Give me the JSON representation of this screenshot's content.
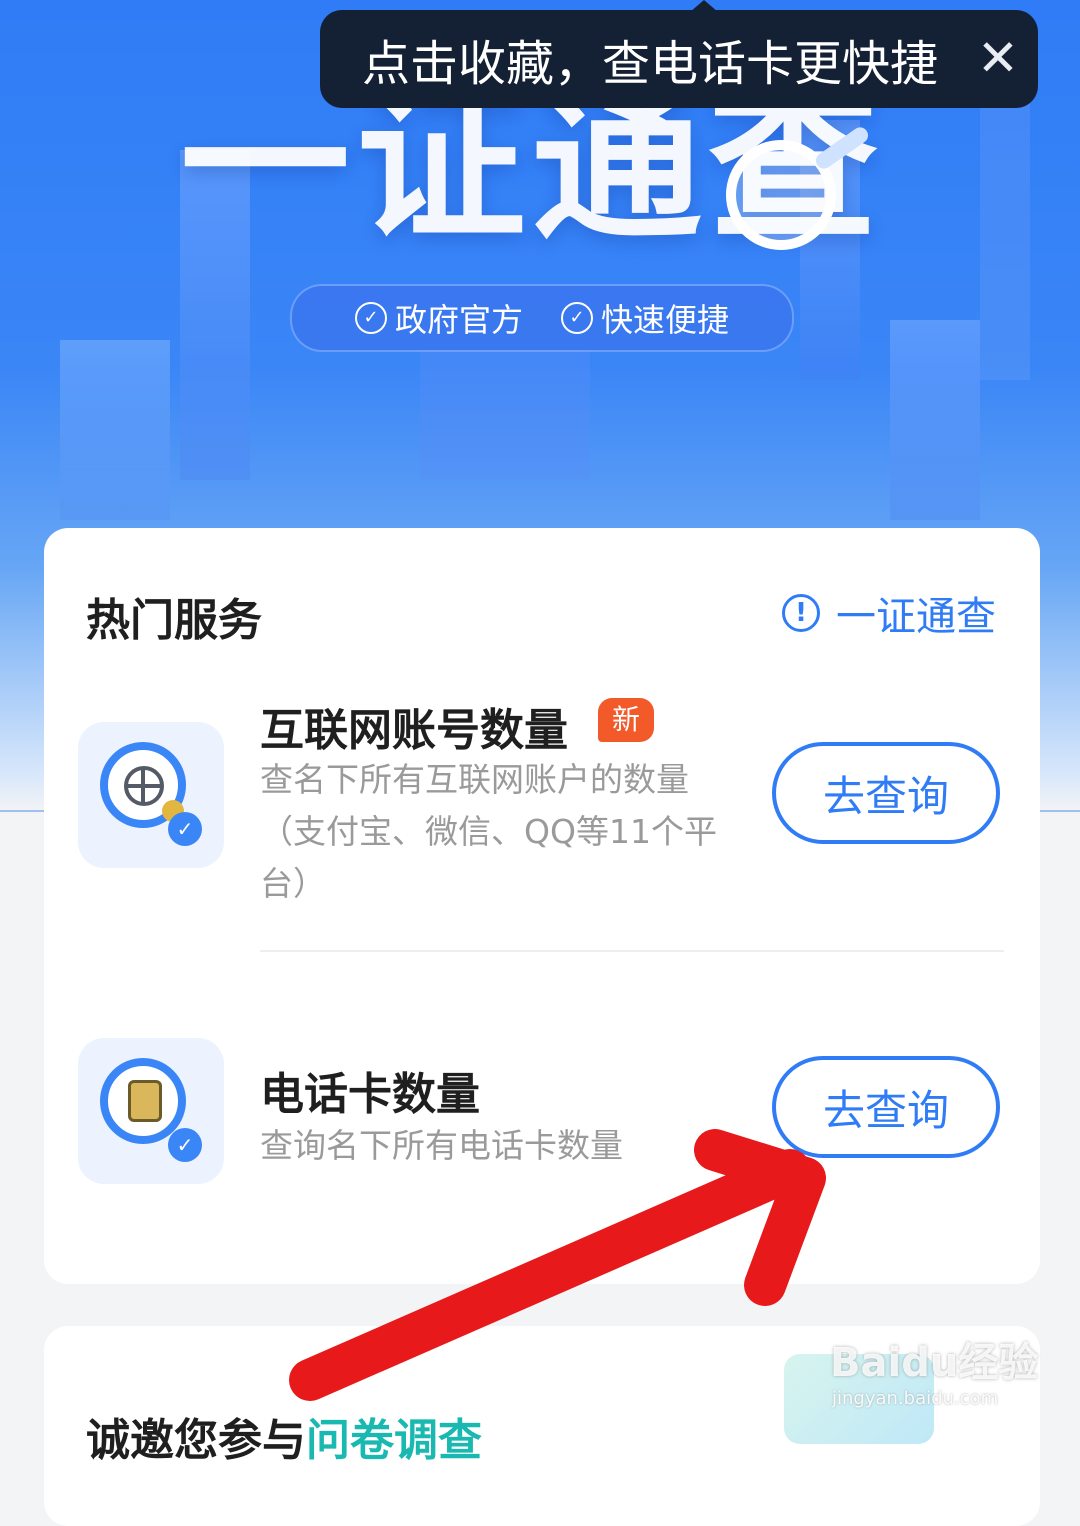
{
  "tooltip": {
    "text": "点击收藏，查电话卡更快捷",
    "close_icon": "close-icon"
  },
  "hero": {
    "title": "一证通查",
    "badges": [
      {
        "label": "政府官方"
      },
      {
        "label": "快速便捷"
      }
    ]
  },
  "services": {
    "title": "热门服务",
    "link_label": "一证通查",
    "items": [
      {
        "name": "互联网账号数量",
        "badge": "新",
        "description_lines": [
          "查名下所有互联网账户的数量",
          "（支付宝、微信、QQ等11个平",
          "台）"
        ],
        "button_label": "去查询",
        "icon": "globe-search-icon"
      },
      {
        "name": "电话卡数量",
        "description_lines": [
          "查询名下所有电话卡数量"
        ],
        "button_label": "去查询",
        "icon": "sim-search-icon"
      }
    ]
  },
  "survey": {
    "prefix": "诚邀您参与",
    "link": "问卷调查"
  },
  "watermark": {
    "main": "Baidu经验",
    "sub": "jingyan.baidu.com"
  },
  "colors": {
    "accent": "#2f7cf6",
    "badge_red": "#f25a2a",
    "annotation_red": "#e8191b",
    "survey_link": "#19b8b0"
  }
}
